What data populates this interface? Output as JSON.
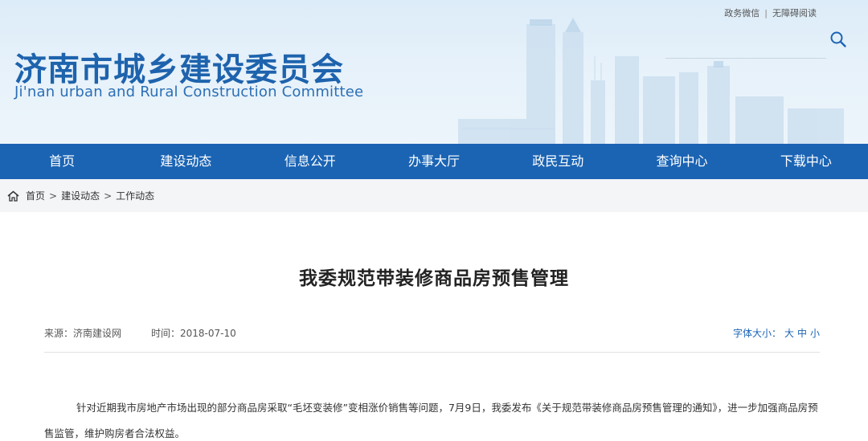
{
  "header": {
    "title": "济南市城乡建设委员会",
    "subtitle": "Ji'nan urban and Rural Construction Committee",
    "top_links": [
      "政务微信",
      "无障碍阅读"
    ],
    "top_link_separator": "|",
    "search_icon": "search-icon"
  },
  "nav": {
    "items": [
      "首页",
      "建设动态",
      "信息公开",
      "办事大厅",
      "政民互动",
      "查询中心",
      "下载中心"
    ]
  },
  "breadcrumb": {
    "icon": "home-icon",
    "items": [
      "首页",
      "建设动态",
      "工作动态"
    ],
    "separator": ">"
  },
  "article": {
    "title": "我委规范带装修商品房预售管理",
    "source": "来源：济南建设网",
    "time": "时间：2018-07-10",
    "font_size_label": "字体大小：",
    "font_size_options": [
      "大",
      "中",
      "小"
    ],
    "body": "针对近期我市房地产市场出现的部分商品房采取“毛坯变装修”变相涨价销售等问题，7月9日，我委发布《关于规范带装修商品房预售管理的通知》，进一步加强商品房预售监管，维护购房者合法权益。"
  },
  "colors": {
    "brand_blue": "#1b64b4",
    "title_blue": "#1e63ad",
    "breadcrumb_bg": "#f3f5f7"
  }
}
